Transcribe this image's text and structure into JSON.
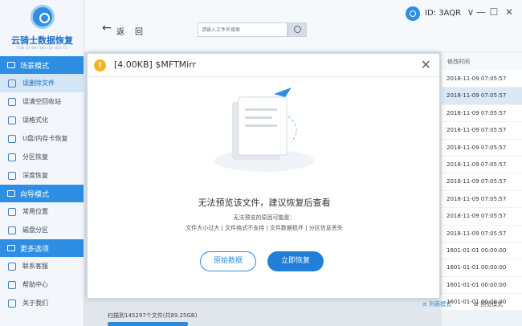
{
  "sidebar": {
    "logo_title": "云骑士数据恢复",
    "logo_sub": "YUN QI SHI SHU JU HUI FU",
    "sections": [
      {
        "title": "场景模式",
        "items": [
          "误删除文件",
          "误清空回收站",
          "误格式化",
          "U盘/内存卡恢复",
          "分区恢复",
          "深度恢复"
        ]
      },
      {
        "title": "向导模式",
        "items": [
          "常用位置",
          "磁盘分区"
        ]
      },
      {
        "title": "更多选项",
        "items": [
          "联系客服",
          "帮助中心",
          "关于我们"
        ]
      }
    ]
  },
  "topbar": {
    "back_label": "返",
    "home_label": "回",
    "search_placeholder": "请输入文件名搜索",
    "user_id": "ID: 3AQR",
    "window_buttons": [
      "∨",
      "—",
      "☐",
      "✕"
    ]
  },
  "table": {
    "column_header": "修改时间",
    "rows": [
      "2018-11-09 07:05:57",
      "2018-11-09 07:05:57",
      "2018-11-09 07:05:57",
      "2018-11-09 07:05:57",
      "2018-11-09 07:05:57",
      "2018-11-09 07:05:57",
      "2018-11-09 07:05:57",
      "2018-11-09 07:05:57",
      "2018-11-09 07:05:57",
      "2018-11-09 07:05:57",
      "1601-01-01 00:00:00",
      "1601-01-01 00:00:00",
      "1601-01-01 00:00:00",
      "1601-01-01 00:00:00"
    ],
    "selected_index": 1
  },
  "view_modes": {
    "list": "列表模式",
    "preview": "预览模式"
  },
  "status": "扫描到145297个文件(共89.25GB)",
  "dialog": {
    "warning_glyph": "!",
    "title": "[4.00KB] $MFTMirr",
    "close_glyph": "✕",
    "message": "无法预览该文件，建议恢复后查看",
    "reason_title": "无法预览的原因可能是：",
    "reasons": "文件大小过大 | 文件格式不支持 | 文件数据损坏 | 分区信息丢失",
    "raw_button": "原始数据",
    "recover_button": "立即恢复"
  },
  "colors": {
    "accent": "#2d8ee3",
    "warning": "#f5b51e"
  }
}
